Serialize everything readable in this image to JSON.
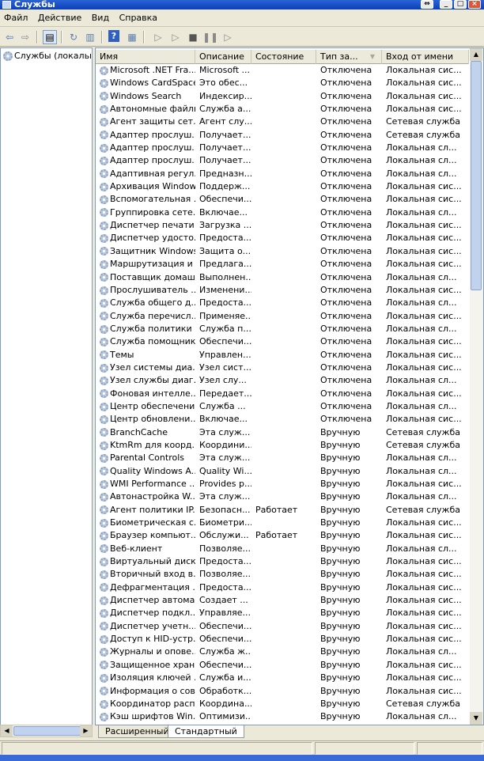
{
  "window": {
    "title": "Службы"
  },
  "menu": [
    {
      "label": "Файл"
    },
    {
      "label": "Действие"
    },
    {
      "label": "Вид"
    },
    {
      "label": "Справка"
    }
  ],
  "tree": {
    "root_label": "Службы (локальные)"
  },
  "columns": {
    "name": "Имя",
    "desc": "Описание",
    "state": "Состояние",
    "type": "Тип за...",
    "logon": "Вход от имени"
  },
  "rows": [
    {
      "name": "Microsoft .NET Fra...",
      "desc": "Microsoft ...",
      "state": "",
      "type": "Отключена",
      "logon": "Локальная сис..."
    },
    {
      "name": "Windows CardSpace",
      "desc": "Это обес...",
      "state": "",
      "type": "Отключена",
      "logon": "Локальная сис..."
    },
    {
      "name": "Windows Search",
      "desc": "Индексир...",
      "state": "",
      "type": "Отключена",
      "logon": "Локальная сис..."
    },
    {
      "name": "Автономные файлы",
      "desc": "Служба а...",
      "state": "",
      "type": "Отключена",
      "logon": "Локальная сис..."
    },
    {
      "name": "Агент защиты сет...",
      "desc": "Агент слу...",
      "state": "",
      "type": "Отключена",
      "logon": "Сетевая служба"
    },
    {
      "name": "Адаптер прослуш...",
      "desc": "Получает...",
      "state": "",
      "type": "Отключена",
      "logon": "Сетевая служба"
    },
    {
      "name": "Адаптер прослуш...",
      "desc": "Получает...",
      "state": "",
      "type": "Отключена",
      "logon": "Локальная сл..."
    },
    {
      "name": "Адаптер прослуш...",
      "desc": "Получает...",
      "state": "",
      "type": "Отключена",
      "logon": "Локальная сл..."
    },
    {
      "name": "Адаптивная регул...",
      "desc": "Предназн...",
      "state": "",
      "type": "Отключена",
      "logon": "Локальная сл..."
    },
    {
      "name": "Архивация Windows",
      "desc": "Поддерж...",
      "state": "",
      "type": "Отключена",
      "logon": "Локальная сис..."
    },
    {
      "name": "Вспомогательная ...",
      "desc": "Обеспечи...",
      "state": "",
      "type": "Отключена",
      "logon": "Локальная сис..."
    },
    {
      "name": "Группировка сете...",
      "desc": "Включае...",
      "state": "",
      "type": "Отключена",
      "logon": "Локальная сл..."
    },
    {
      "name": "Диспетчер печати",
      "desc": "Загрузка ...",
      "state": "",
      "type": "Отключена",
      "logon": "Локальная сис..."
    },
    {
      "name": "Диспетчер удосто...",
      "desc": "Предоста...",
      "state": "",
      "type": "Отключена",
      "logon": "Локальная сис..."
    },
    {
      "name": "Защитник Windows",
      "desc": "Защита о...",
      "state": "",
      "type": "Отключена",
      "logon": "Локальная сис..."
    },
    {
      "name": "Маршрутизация и ...",
      "desc": "Предлага...",
      "state": "",
      "type": "Отключена",
      "logon": "Локальная сис..."
    },
    {
      "name": "Поставщик домаш...",
      "desc": "Выполнен...",
      "state": "",
      "type": "Отключена",
      "logon": "Локальная сл..."
    },
    {
      "name": "Прослушиватель ...",
      "desc": "Изменени...",
      "state": "",
      "type": "Отключена",
      "logon": "Локальная сис..."
    },
    {
      "name": "Служба общего д...",
      "desc": "Предоста...",
      "state": "",
      "type": "Отключена",
      "logon": "Локальная сл..."
    },
    {
      "name": "Служба перечисл...",
      "desc": "Применяе...",
      "state": "",
      "type": "Отключена",
      "logon": "Локальная сис..."
    },
    {
      "name": "Служба политики ...",
      "desc": "Служба п...",
      "state": "",
      "type": "Отключена",
      "logon": "Локальная сл..."
    },
    {
      "name": "Служба помощник...",
      "desc": "Обеспечи...",
      "state": "",
      "type": "Отключена",
      "logon": "Локальная сис..."
    },
    {
      "name": "Темы",
      "desc": "Управлен...",
      "state": "",
      "type": "Отключена",
      "logon": "Локальная сис..."
    },
    {
      "name": "Узел системы диа...",
      "desc": "Узел сист...",
      "state": "",
      "type": "Отключена",
      "logon": "Локальная сис..."
    },
    {
      "name": "Узел службы диаг...",
      "desc": "Узел слу...",
      "state": "",
      "type": "Отключена",
      "logon": "Локальная сл..."
    },
    {
      "name": "Фоновая интелле...",
      "desc": "Передает...",
      "state": "",
      "type": "Отключена",
      "logon": "Локальная сис..."
    },
    {
      "name": "Центр обеспечени...",
      "desc": "Служба ...",
      "state": "",
      "type": "Отключена",
      "logon": "Локальная сл..."
    },
    {
      "name": "Центр обновлени...",
      "desc": "Включае...",
      "state": "",
      "type": "Отключена",
      "logon": "Локальная сис..."
    },
    {
      "name": "BranchCache",
      "desc": "Эта служ...",
      "state": "",
      "type": "Вручную",
      "logon": "Сетевая служба"
    },
    {
      "name": "KtmRm для коорд...",
      "desc": "Координи...",
      "state": "",
      "type": "Вручную",
      "logon": "Сетевая служба"
    },
    {
      "name": "Parental Controls",
      "desc": "Эта служ...",
      "state": "",
      "type": "Вручную",
      "logon": "Локальная сл..."
    },
    {
      "name": "Quality Windows A...",
      "desc": "Quality Wi...",
      "state": "",
      "type": "Вручную",
      "logon": "Локальная сл..."
    },
    {
      "name": "WMI Performance ...",
      "desc": "Provides p...",
      "state": "",
      "type": "Вручную",
      "logon": "Локальная сис..."
    },
    {
      "name": "Автонастройка W...",
      "desc": "Эта служ...",
      "state": "",
      "type": "Вручную",
      "logon": "Локальная сл..."
    },
    {
      "name": "Агент политики IP...",
      "desc": "Безопасн...",
      "state": "Работает",
      "type": "Вручную",
      "logon": "Сетевая служба"
    },
    {
      "name": "Биометрическая с...",
      "desc": "Биометри...",
      "state": "",
      "type": "Вручную",
      "logon": "Локальная сис..."
    },
    {
      "name": "Браузер компьют...",
      "desc": "Обслужи...",
      "state": "Работает",
      "type": "Вручную",
      "logon": "Локальная сис..."
    },
    {
      "name": "Веб-клиент",
      "desc": "Позволяе...",
      "state": "",
      "type": "Вручную",
      "logon": "Локальная сл..."
    },
    {
      "name": "Виртуальный диск",
      "desc": "Предоста...",
      "state": "",
      "type": "Вручную",
      "logon": "Локальная сис..."
    },
    {
      "name": "Вторичный вход в...",
      "desc": "Позволяе...",
      "state": "",
      "type": "Вручную",
      "logon": "Локальная сис..."
    },
    {
      "name": "Дефрагментация ...",
      "desc": "Предоста...",
      "state": "",
      "type": "Вручную",
      "logon": "Локальная сис..."
    },
    {
      "name": "Диспетчер автома...",
      "desc": "Создает ...",
      "state": "",
      "type": "Вручную",
      "logon": "Локальная сис..."
    },
    {
      "name": "Диспетчер подкл...",
      "desc": "Управляе...",
      "state": "",
      "type": "Вручную",
      "logon": "Локальная сис..."
    },
    {
      "name": "Диспетчер учетн...",
      "desc": "Обеспечи...",
      "state": "",
      "type": "Вручную",
      "logon": "Локальная сис..."
    },
    {
      "name": "Доступ к HID-устр...",
      "desc": "Обеспечи...",
      "state": "",
      "type": "Вручную",
      "logon": "Локальная сис..."
    },
    {
      "name": "Журналы и опове...",
      "desc": "Служба ж...",
      "state": "",
      "type": "Вручную",
      "logon": "Локальная сл..."
    },
    {
      "name": "Защищенное хран...",
      "desc": "Обеспечи...",
      "state": "",
      "type": "Вручную",
      "logon": "Локальная сис..."
    },
    {
      "name": "Изоляция ключей ...",
      "desc": "Служба и...",
      "state": "",
      "type": "Вручную",
      "logon": "Локальная сис..."
    },
    {
      "name": "Информация о сов...",
      "desc": "Обработк...",
      "state": "",
      "type": "Вручную",
      "logon": "Локальная сис..."
    },
    {
      "name": "Координатор расп...",
      "desc": "Координа...",
      "state": "",
      "type": "Вручную",
      "logon": "Сетевая служба"
    },
    {
      "name": "Кэш шрифтов Win...",
      "desc": "Оптимизи...",
      "state": "",
      "type": "Вручную",
      "logon": "Локальная сл..."
    }
  ],
  "tabs": [
    {
      "label": "Расширенный"
    },
    {
      "label": "Стандартный"
    }
  ]
}
